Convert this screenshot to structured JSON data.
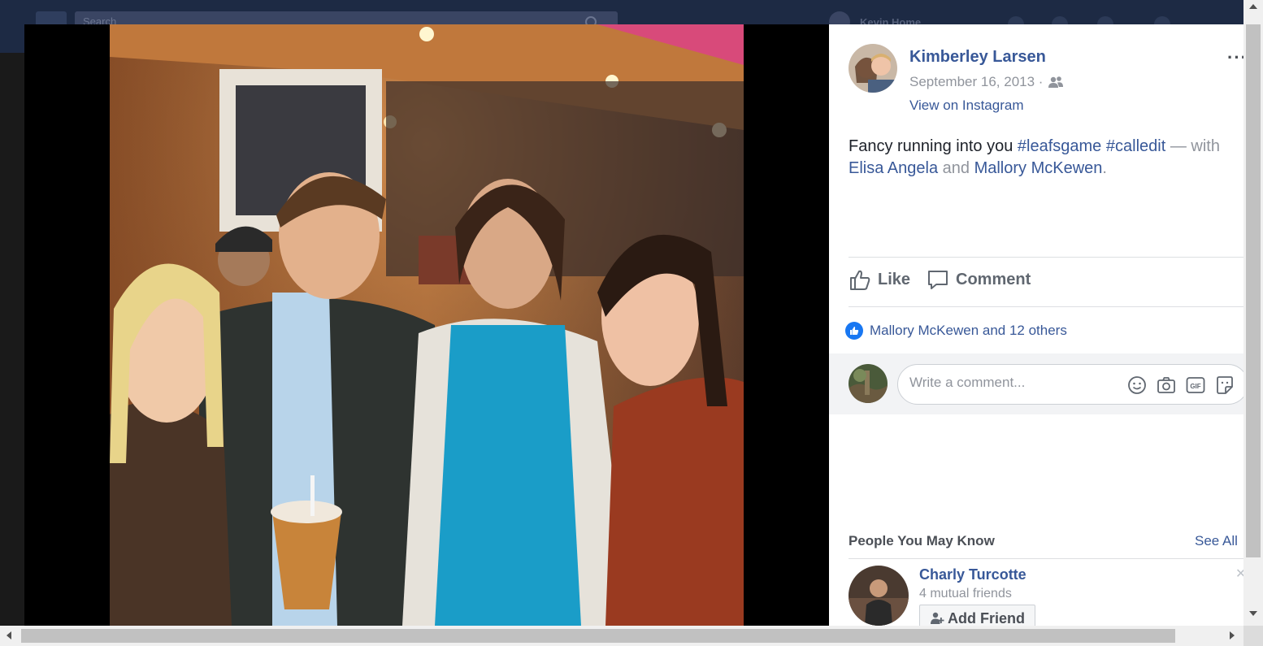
{
  "background": {
    "search_placeholder": "Search",
    "username": "Kevin    Home"
  },
  "post": {
    "author": "Kimberley Larsen",
    "date": "September 16, 2013 ·",
    "audience_icon": "friends-icon",
    "instagram_link": "View on Instagram",
    "more_menu": "···",
    "caption": {
      "text": "Fancy running into you",
      "hashtag_1": "#leafsgame",
      "hashtag_2": "#calledit",
      "with_label": "— with",
      "tagged_1": "Elisa Angela",
      "and_label": "and",
      "tagged_2": "Mallory McKewen",
      "end": "."
    }
  },
  "actions": {
    "like_label": "Like",
    "comment_label": "Comment"
  },
  "reactions": {
    "summary": "Mallory McKewen and 12 others"
  },
  "comment_box": {
    "placeholder": "Write a comment...",
    "icons": [
      "emoji-icon",
      "camera-icon",
      "gif-icon",
      "sticker-icon"
    ]
  },
  "people_you_may_know": {
    "title": "People You May Know",
    "see_all": "See All",
    "suggestions": [
      {
        "name": "Charly Turcotte",
        "mutual": "4 mutual friends",
        "button_label": "Add Friend"
      }
    ]
  },
  "colors": {
    "link": "#385898",
    "muted": "#90949c",
    "like_blue": "#1877f2"
  }
}
